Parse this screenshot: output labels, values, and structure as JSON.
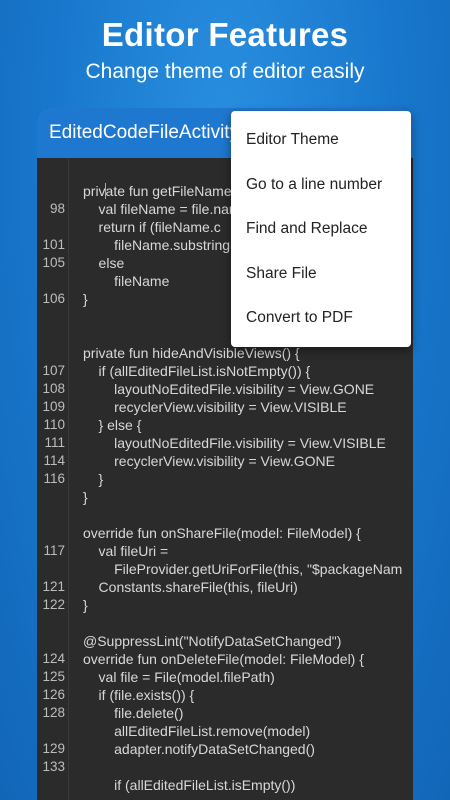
{
  "promo": {
    "title": "Editor Features",
    "subtitle": "Change theme of editor easily"
  },
  "appbar": {
    "title": "EditedCodeFileActivity"
  },
  "menu": {
    "items": [
      {
        "label": "Editor Theme"
      },
      {
        "label": "Go to a line number"
      },
      {
        "label": "Find and Replace"
      },
      {
        "label": "Share File"
      },
      {
        "label": "Convert to PDF"
      }
    ]
  },
  "code": {
    "lines": [
      {
        "num": "",
        "text": "private fun getFileName"
      },
      {
        "num": "98",
        "text": "    val fileName = file.name"
      },
      {
        "num": "",
        "text": "    return if (fileName.c"
      },
      {
        "num": "101",
        "text": "        fileName.substring("
      },
      {
        "num": "105",
        "text": "    else"
      },
      {
        "num": "",
        "text": "        fileName"
      },
      {
        "num": "106",
        "text": "}"
      },
      {
        "num": "",
        "text": ""
      },
      {
        "num": "",
        "text": ""
      },
      {
        "num": "",
        "text": "private fun hideAndVisibleViews() {"
      },
      {
        "num": "107",
        "text": "    if (allEditedFileList.isNotEmpty()) {"
      },
      {
        "num": "108",
        "text": "        layoutNoEditedFile.visibility = View.GONE"
      },
      {
        "num": "109",
        "text": "        recyclerView.visibility = View.VISIBLE"
      },
      {
        "num": "110",
        "text": "    } else {"
      },
      {
        "num": "111",
        "text": "        layoutNoEditedFile.visibility = View.VISIBLE"
      },
      {
        "num": "114",
        "text": "        recyclerView.visibility = View.GONE"
      },
      {
        "num": "116",
        "text": "    }"
      },
      {
        "num": "",
        "text": "}"
      },
      {
        "num": "",
        "text": ""
      },
      {
        "num": "",
        "text": "override fun onShareFile(model: FileModel) {"
      },
      {
        "num": "117",
        "text": "    val fileUri ="
      },
      {
        "num": "",
        "text": "        FileProvider.getUriForFile(this, \"$packageNam"
      },
      {
        "num": "121",
        "text": "    Constants.shareFile(this, fileUri)"
      },
      {
        "num": "122",
        "text": "}"
      },
      {
        "num": "",
        "text": ""
      },
      {
        "num": "",
        "text": "@SuppressLint(\"NotifyDataSetChanged\")"
      },
      {
        "num": "124",
        "text": "override fun onDeleteFile(model: FileModel) {"
      },
      {
        "num": "125",
        "text": "    val file = File(model.filePath)"
      },
      {
        "num": "126",
        "text": "    if (file.exists()) {"
      },
      {
        "num": "128",
        "text": "        file.delete()"
      },
      {
        "num": "",
        "text": "        allEditedFileList.remove(model)"
      },
      {
        "num": "129",
        "text": "        adapter.notifyDataSetChanged()"
      },
      {
        "num": "133",
        "text": ""
      },
      {
        "num": "",
        "text": "        if (allEditedFileList.isEmpty())"
      }
    ]
  }
}
